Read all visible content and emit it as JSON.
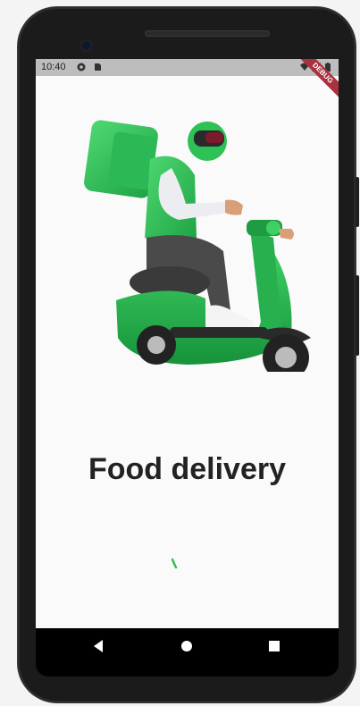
{
  "status_bar": {
    "time": "10:40"
  },
  "debug_banner": "DEBUG",
  "screen": {
    "title": "Food delivery"
  },
  "colors": {
    "accent": "#2fbf4f",
    "status_bar": "#bdbdbd",
    "debug": "#a8323e"
  },
  "icons": {
    "status": [
      "settings-icon",
      "sd-card-icon",
      "wifi-icon",
      "signal-icon",
      "battery-icon"
    ],
    "nav": [
      "back-icon",
      "home-icon",
      "recents-icon"
    ]
  }
}
